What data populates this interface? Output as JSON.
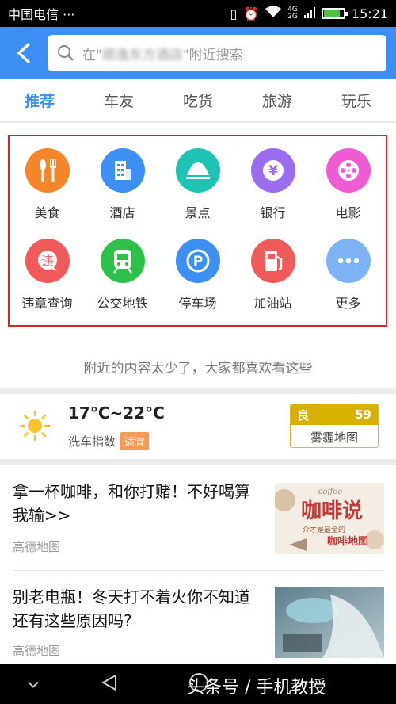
{
  "status": {
    "carrier": "中国电信",
    "dots": "···",
    "time": "15:21",
    "net_top": "4G",
    "net_bottom": "2G",
    "battery_level": 0.85
  },
  "search": {
    "prefix": "在\"",
    "hotel": "顺逸东方酒店",
    "suffix": "\"附近搜索"
  },
  "tabs": [
    "推荐",
    "车友",
    "吃货",
    "旅游",
    "玩乐"
  ],
  "categories": [
    {
      "label": "美食",
      "color": "#f5852a",
      "icon": "fork-knife"
    },
    {
      "label": "酒店",
      "color": "#3d8ef5",
      "icon": "building"
    },
    {
      "label": "景点",
      "color": "#1ec3b4",
      "icon": "landmark"
    },
    {
      "label": "银行",
      "color": "#9b6cf0",
      "icon": "yuan"
    },
    {
      "label": "电影",
      "color": "#ef5bd2",
      "icon": "film-reel"
    },
    {
      "label": "违章查询",
      "color": "#f15a5a",
      "icon": "violation"
    },
    {
      "label": "公交地铁",
      "color": "#2fc04b",
      "icon": "subway"
    },
    {
      "label": "停车场",
      "color": "#3d8ef5",
      "icon": "parking"
    },
    {
      "label": "加油站",
      "color": "#f15a5a",
      "icon": "fuel"
    },
    {
      "label": "更多",
      "color": "#7db2f5",
      "icon": "more"
    }
  ],
  "hint": "附近的内容太少了，大家都喜欢看这些",
  "weather": {
    "temp": "17°C~22°C",
    "wash_label": "洗车指数",
    "wash_badge": "适宜",
    "aqi_label": "良",
    "aqi_value": "59",
    "aqi_source": "雾霾地图"
  },
  "articles": [
    {
      "title": "拿一杯咖啡，和你打赌！不好喝算我输>>",
      "source": "高德地图",
      "thumb_small": "coffee",
      "thumb_big": "咖啡说",
      "thumb_sub": "介才是最全的",
      "thumb_sub2": "咖啡地图"
    },
    {
      "title": "别老电瓶！冬天打不着火你不知道还有这些原因吗?",
      "source": "高德地图"
    }
  ],
  "watermark": "头条号 / 手机教授"
}
